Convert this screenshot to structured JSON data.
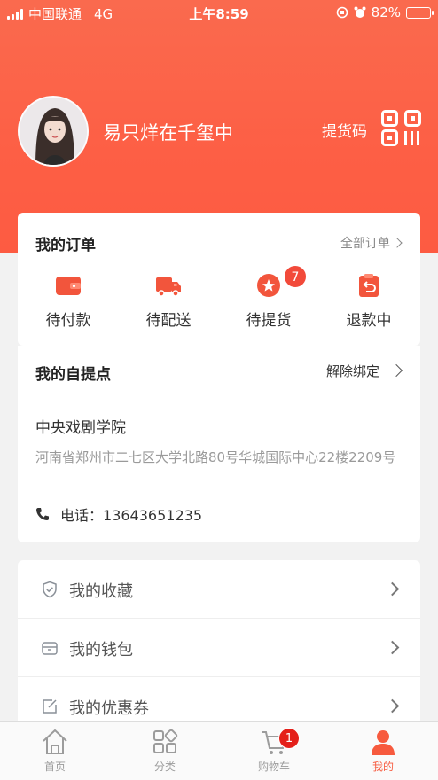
{
  "status_bar": {
    "carrier": "中国联通",
    "network": "4G",
    "time": "上午8:59",
    "battery": "82%",
    "battery_level": 0.82
  },
  "profile": {
    "username": "易只烊在千玺中",
    "pickup_code_label": "提货码"
  },
  "orders": {
    "title": "我的订单",
    "all_orders_label": "全部订单",
    "items": [
      {
        "label": "待付款",
        "icon": "wallet-icon"
      },
      {
        "label": "待配送",
        "icon": "delivery-truck-icon"
      },
      {
        "label": "待提货",
        "icon": "pickup-star-icon",
        "badge": "7"
      },
      {
        "label": "退款中",
        "icon": "refund-clipboard-icon"
      }
    ]
  },
  "pickup_point": {
    "title": "我的自提点",
    "unbind_label": "解除绑定",
    "name": "中央戏剧学院",
    "address": "河南省郑州市二七区大学北路80号华城国际中心22楼2209号",
    "phone_label": "电话：",
    "phone": "13643651235"
  },
  "menu": [
    {
      "label": "我的收藏",
      "icon": "shield-check-icon"
    },
    {
      "label": "我的钱包",
      "icon": "wallet-outline-icon"
    },
    {
      "label": "我的优惠券",
      "icon": "coupon-edit-icon"
    }
  ],
  "tabbar": [
    {
      "label": "首页",
      "icon": "home-icon"
    },
    {
      "label": "分类",
      "icon": "category-grid-icon"
    },
    {
      "label": "购物车",
      "icon": "cart-icon",
      "badge": "1"
    },
    {
      "label": "我的",
      "icon": "user-icon",
      "active": true
    }
  ],
  "colors": {
    "primary": "#fd5f45",
    "accent_orange": "#f75a3e",
    "badge_red": "#e4201a"
  }
}
